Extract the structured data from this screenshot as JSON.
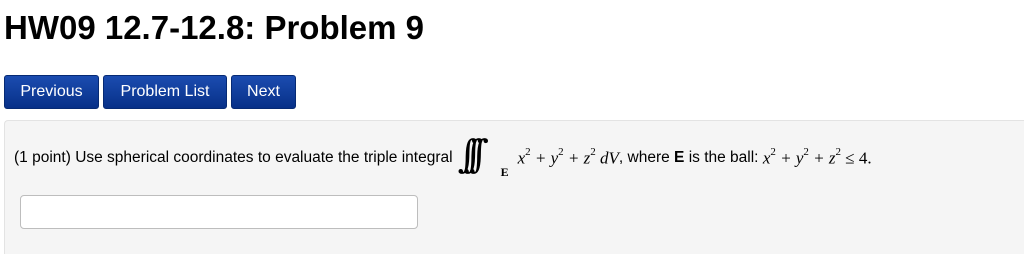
{
  "header": {
    "title": "HW09 12.7-12.8: Problem 9"
  },
  "nav": {
    "previous_label": "Previous",
    "problem_list_label": "Problem List",
    "next_label": "Next"
  },
  "problem": {
    "points": "(1 point)",
    "intro": "Use spherical coordinates to evaluate the triple integral",
    "integral_symbol": "∫∫∫",
    "integral_region": "E",
    "integrand": "x² + y² + z² dV",
    "comma": ",",
    "where": "where",
    "region_name": "E",
    "region_desc": "is the ball:",
    "ball_inequality": "x² + y² + z² ≤ 4.",
    "answer_value": "",
    "answer_placeholder": ""
  },
  "colors": {
    "button_bg": "#0d3a96",
    "button_text": "#ffffff",
    "panel_bg": "#f5f5f5"
  }
}
